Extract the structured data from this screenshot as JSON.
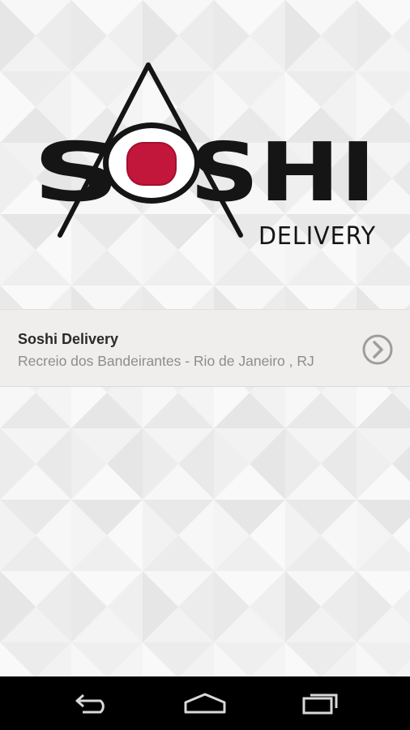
{
  "brand": {
    "logo_word": "SOSHI",
    "logo_sub": "DELIVERY",
    "accent_color": "#c2173a",
    "dark_color": "#151515"
  },
  "stores": [
    {
      "name": "Soshi Delivery",
      "address": "Recreio dos Bandeirantes - Rio de Janeiro , RJ",
      "icon": "chevron-right-circle-icon"
    }
  ],
  "navbar": {
    "back_icon": "back-icon",
    "home_icon": "home-icon",
    "recent_icon": "recent-apps-icon"
  }
}
